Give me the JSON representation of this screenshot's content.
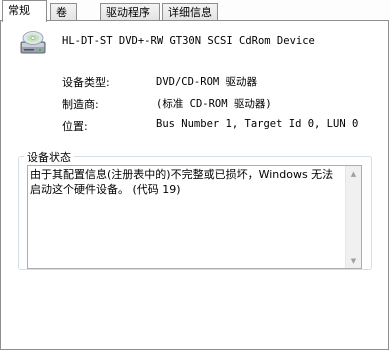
{
  "tabs": [
    {
      "label": "常规"
    },
    {
      "label": "卷"
    },
    {
      "label": "驱动程序"
    },
    {
      "label": "详细信息"
    }
  ],
  "device": {
    "name": "HL-DT-ST DVD+-RW GT30N SCSI CdRom Device",
    "icon": "dvd-drive-icon"
  },
  "properties": [
    {
      "label": "设备类型:",
      "value": "DVD/CD-ROM 驱动器"
    },
    {
      "label": "制造商:",
      "value": "(标准 CD-ROM 驱动器)"
    },
    {
      "label": "位置:",
      "value": "Bus Number 1, Target Id 0, LUN 0"
    }
  ],
  "status": {
    "title": "设备状态",
    "text": "由于其配置信息(注册表中的)不完整或已损坏，Windows 无法启动这个硬件设备。 (代码 19)"
  },
  "scrollbar": {
    "up_arrow": "▲",
    "down_arrow": "▼"
  }
}
